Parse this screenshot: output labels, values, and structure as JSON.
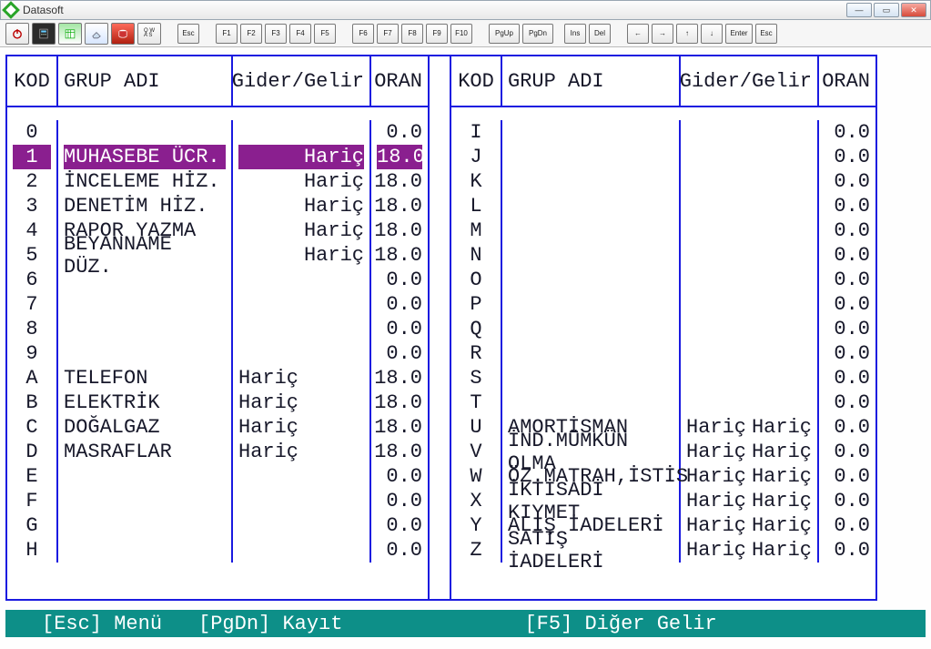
{
  "window": {
    "title": "Datasoft"
  },
  "headers": {
    "kod": "KOD",
    "grup": "GRUP ADI",
    "gg": "Gider/Gelir",
    "oran": "ORAN"
  },
  "left_rows": [
    {
      "kod": "0",
      "name": "",
      "gg_left": "",
      "gg_right": "",
      "oran": "0.0",
      "sel": false
    },
    {
      "kod": "1",
      "name": "MUHASEBE ÜCR.",
      "gg_left": "",
      "gg_right": "Hariç",
      "oran": "18.0",
      "sel": true
    },
    {
      "kod": "2",
      "name": "İNCELEME HİZ.",
      "gg_left": "",
      "gg_right": "Hariç",
      "oran": "18.0",
      "sel": false
    },
    {
      "kod": "3",
      "name": "DENETİM HİZ.",
      "gg_left": "",
      "gg_right": "Hariç",
      "oran": "18.0",
      "sel": false
    },
    {
      "kod": "4",
      "name": "RAPOR YAZMA",
      "gg_left": "",
      "gg_right": "Hariç",
      "oran": "18.0",
      "sel": false
    },
    {
      "kod": "5",
      "name": "BEYANNAME DÜZ.",
      "gg_left": "",
      "gg_right": "Hariç",
      "oran": "18.0",
      "sel": false
    },
    {
      "kod": "6",
      "name": "",
      "gg_left": "",
      "gg_right": "",
      "oran": "0.0",
      "sel": false
    },
    {
      "kod": "7",
      "name": "",
      "gg_left": "",
      "gg_right": "",
      "oran": "0.0",
      "sel": false
    },
    {
      "kod": "8",
      "name": "",
      "gg_left": "",
      "gg_right": "",
      "oran": "0.0",
      "sel": false
    },
    {
      "kod": "9",
      "name": "",
      "gg_left": "",
      "gg_right": "",
      "oran": "0.0",
      "sel": false
    },
    {
      "kod": "A",
      "name": "TELEFON",
      "gg_left": "Hariç",
      "gg_right": "",
      "oran": "18.0",
      "sel": false
    },
    {
      "kod": "B",
      "name": "ELEKTRİK",
      "gg_left": "Hariç",
      "gg_right": "",
      "oran": "18.0",
      "sel": false
    },
    {
      "kod": "C",
      "name": "DOĞALGAZ",
      "gg_left": "Hariç",
      "gg_right": "",
      "oran": "18.0",
      "sel": false
    },
    {
      "kod": "D",
      "name": "MASRAFLAR",
      "gg_left": "Hariç",
      "gg_right": "",
      "oran": "18.0",
      "sel": false
    },
    {
      "kod": "E",
      "name": "",
      "gg_left": "",
      "gg_right": "",
      "oran": "0.0",
      "sel": false
    },
    {
      "kod": "F",
      "name": "",
      "gg_left": "",
      "gg_right": "",
      "oran": "0.0",
      "sel": false
    },
    {
      "kod": "G",
      "name": "",
      "gg_left": "",
      "gg_right": "",
      "oran": "0.0",
      "sel": false
    },
    {
      "kod": "H",
      "name": "",
      "gg_left": "",
      "gg_right": "",
      "oran": "0.0",
      "sel": false
    }
  ],
  "right_rows": [
    {
      "kod": "I",
      "name": "",
      "gg_left": "",
      "gg_right": "",
      "oran": "0.0"
    },
    {
      "kod": "J",
      "name": "",
      "gg_left": "",
      "gg_right": "",
      "oran": "0.0"
    },
    {
      "kod": "K",
      "name": "",
      "gg_left": "",
      "gg_right": "",
      "oran": "0.0"
    },
    {
      "kod": "L",
      "name": "",
      "gg_left": "",
      "gg_right": "",
      "oran": "0.0"
    },
    {
      "kod": "M",
      "name": "",
      "gg_left": "",
      "gg_right": "",
      "oran": "0.0"
    },
    {
      "kod": "N",
      "name": "",
      "gg_left": "",
      "gg_right": "",
      "oran": "0.0"
    },
    {
      "kod": "O",
      "name": "",
      "gg_left": "",
      "gg_right": "",
      "oran": "0.0"
    },
    {
      "kod": "P",
      "name": "",
      "gg_left": "",
      "gg_right": "",
      "oran": "0.0"
    },
    {
      "kod": "Q",
      "name": "",
      "gg_left": "",
      "gg_right": "",
      "oran": "0.0"
    },
    {
      "kod": "R",
      "name": "",
      "gg_left": "",
      "gg_right": "",
      "oran": "0.0"
    },
    {
      "kod": "S",
      "name": "",
      "gg_left": "",
      "gg_right": "",
      "oran": "0.0"
    },
    {
      "kod": "T",
      "name": "",
      "gg_left": "",
      "gg_right": "",
      "oran": "0.0"
    },
    {
      "kod": "U",
      "name": "AMORTİSMAN",
      "gg_left": "Hariç",
      "gg_right": "Hariç",
      "oran": "0.0"
    },
    {
      "kod": "V",
      "name": "İND.MÜMKÜN OLMA",
      "gg_left": "Hariç",
      "gg_right": "Hariç",
      "oran": "0.0"
    },
    {
      "kod": "W",
      "name": "ÖZ.MATRAH,İSTİS",
      "gg_left": "Hariç",
      "gg_right": "Hariç",
      "oran": "0.0"
    },
    {
      "kod": "X",
      "name": "İKTİSADİ KIYMET",
      "gg_left": "Hariç",
      "gg_right": "Hariç",
      "oran": "0.0"
    },
    {
      "kod": "Y",
      "name": "ALIŞ İADELERİ",
      "gg_left": "Hariç",
      "gg_right": "Hariç",
      "oran": "0.0"
    },
    {
      "kod": "Z",
      "name": "SATIŞ İADELERİ",
      "gg_left": "Hariç",
      "gg_right": "Hariç",
      "oran": "0.0"
    }
  ],
  "status": {
    "left": "[Esc] Menü",
    "mid": "[PgDn] Kayıt",
    "right": "[F5] Diğer Gelir"
  },
  "toolbar_keys": {
    "esc": "Esc",
    "f1": "F1",
    "f2": "F2",
    "f3": "F3",
    "f4": "F4",
    "f5": "F5",
    "f6": "F6",
    "f7": "F7",
    "f8": "F8",
    "f9": "F9",
    "f10": "F10",
    "pgup": "PgUp",
    "pgdn": "PgDn",
    "ins": "Ins",
    "del": "Del",
    "enter": "Enter"
  }
}
